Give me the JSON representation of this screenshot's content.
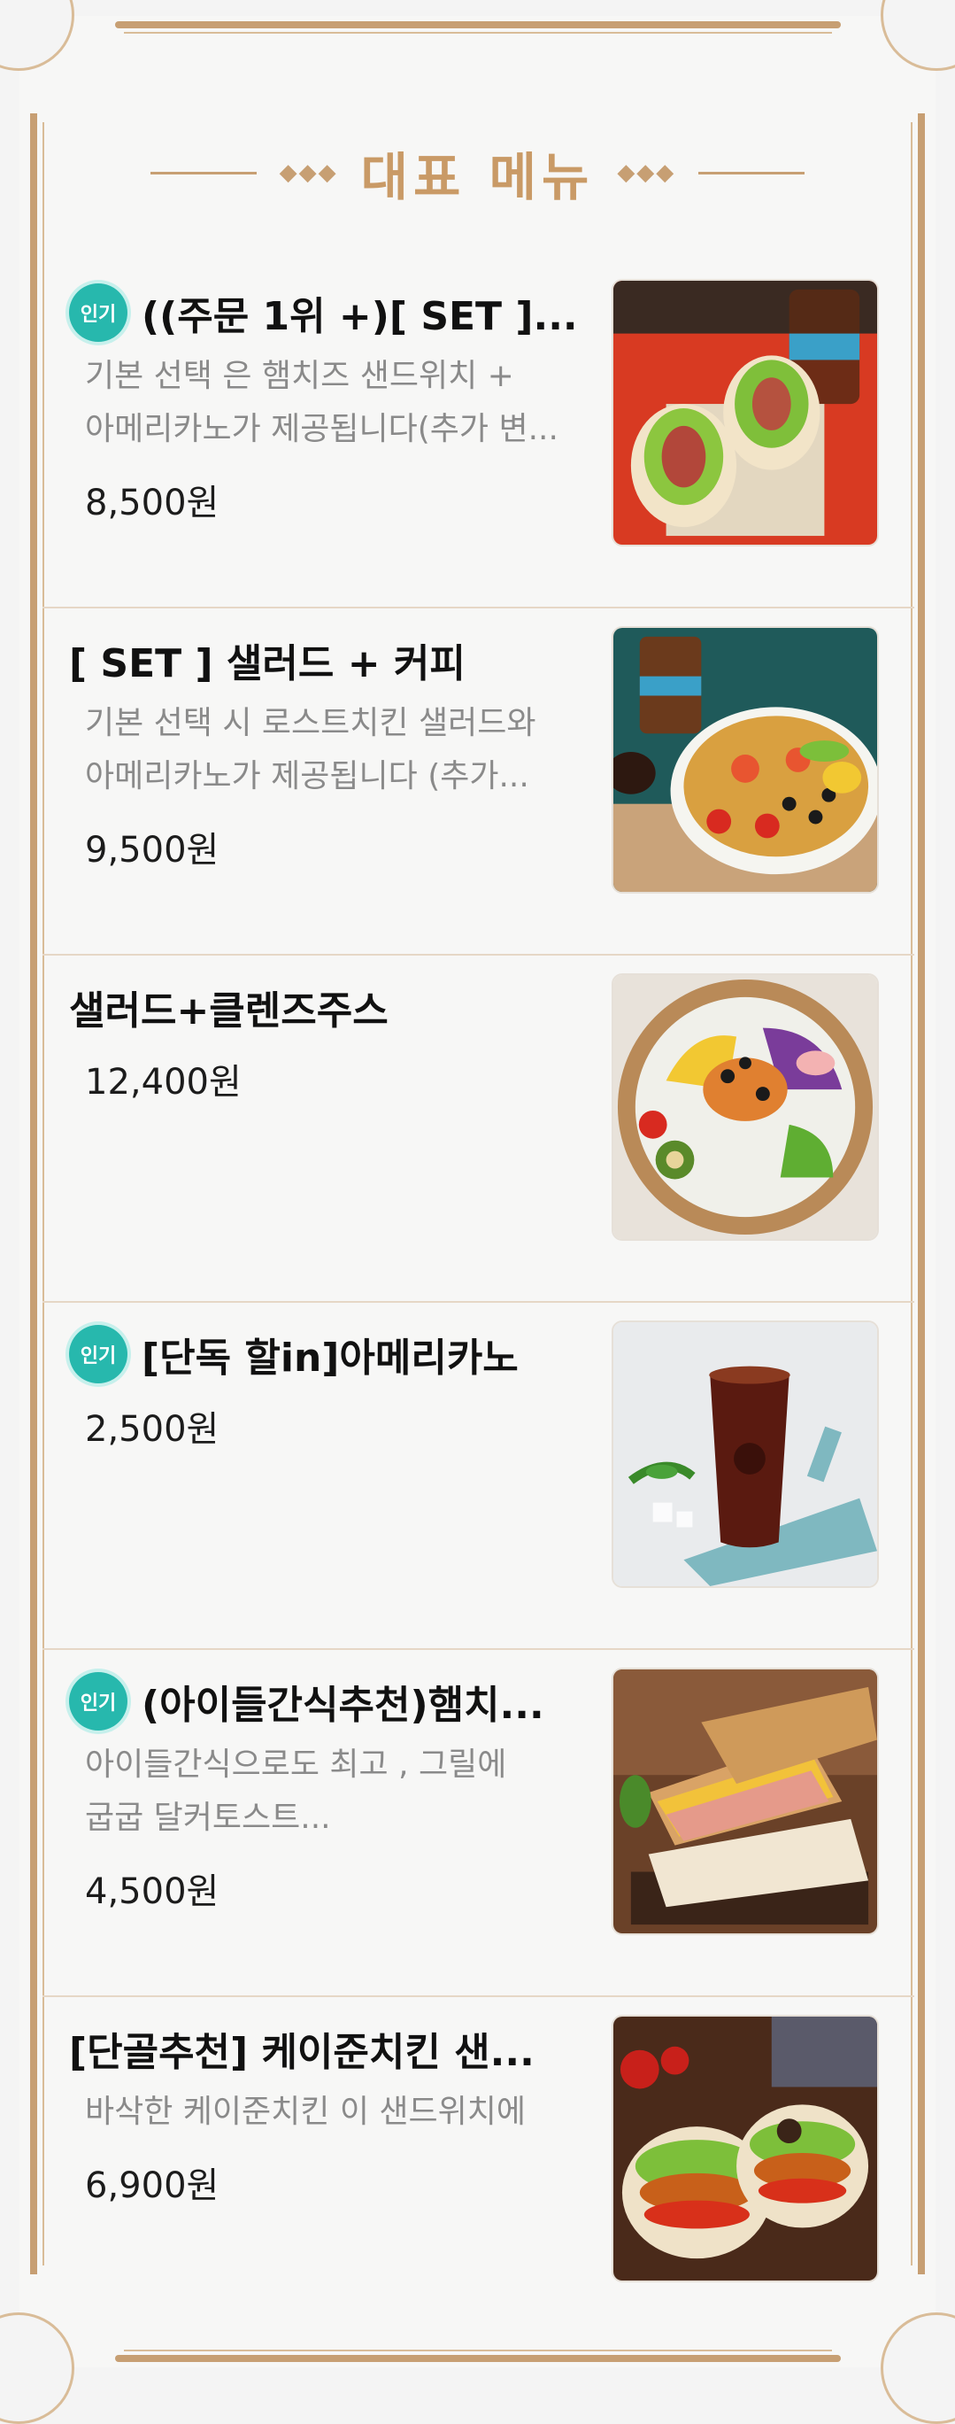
{
  "header": {
    "title": "대표 메뉴"
  },
  "badge_label": "인기",
  "items": [
    {
      "name": "((주문 1위 +)[ SET ]...",
      "popular": true,
      "desc_lines": [
        "기본 선택 은 햄치즈 샌드위치 +",
        "아메리카노가 제공됩니다(추가 변..."
      ],
      "price": "8,500원",
      "image": "sandwich-set-with-iced-coffee"
    },
    {
      "name": "[ SET ] 샐러드 + 커피",
      "popular": false,
      "desc_lines": [
        "기본 선택 시 로스트치킨 샐러드와",
        "아메리카노가 제공됩니다 (추가..."
      ],
      "price": "9,500원",
      "image": "salad-bowl-with-coffee"
    },
    {
      "name": "샐러드+클렌즈주스",
      "popular": false,
      "desc_lines": [],
      "price": "12,400원",
      "image": "salad-bowl"
    },
    {
      "name": "[단독 할in]아메리카노",
      "popular": true,
      "desc_lines": [],
      "price": "2,500원",
      "image": "iced-americano"
    },
    {
      "name": "(아이들간식추천)햄치...",
      "popular": true,
      "desc_lines": [
        "아이들간식으로도 최고 , 그릴에",
        "굽굽 달커토스트..."
      ],
      "price": "4,500원",
      "image": "ham-cheese-toast"
    },
    {
      "name": "[단골추천] 케이준치킨 샌...",
      "popular": false,
      "desc_lines": [
        "바삭한 케이준치킨 이 샌드위치에"
      ],
      "price": "6,900원",
      "image": "cajun-chicken-sandwich"
    }
  ]
}
